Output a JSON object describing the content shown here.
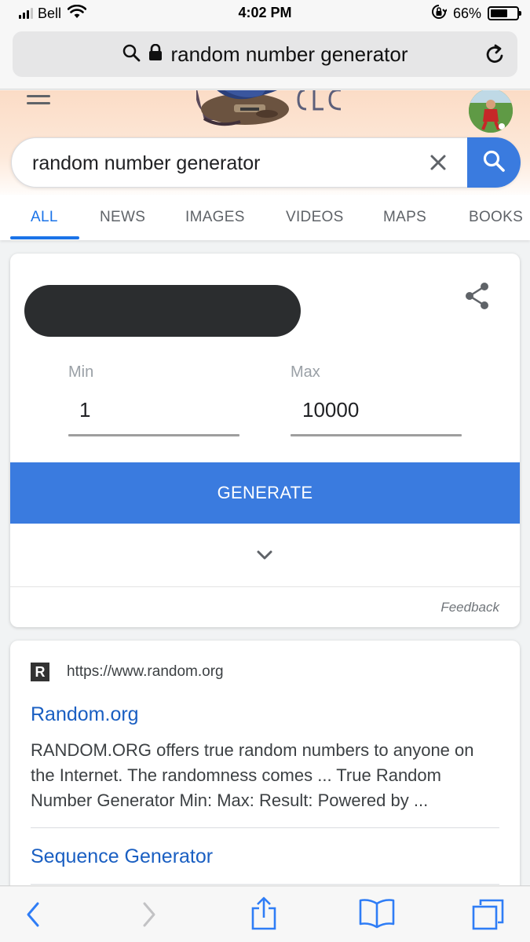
{
  "status_bar": {
    "carrier": "Bell",
    "time": "4:02 PM",
    "battery_percent": "66%",
    "battery_level": 0.66,
    "icons": [
      "signal-icon",
      "wifi-icon",
      "orientation-lock-icon",
      "battery-icon"
    ]
  },
  "address_bar": {
    "text": "random number generator",
    "icons": [
      "search-icon",
      "lock-icon",
      "reload-icon"
    ]
  },
  "search": {
    "query": "random number generator",
    "icons": [
      "menu-icon",
      "clear-icon",
      "search-icon"
    ]
  },
  "tabs": [
    {
      "label": "ALL",
      "active": true
    },
    {
      "label": "NEWS"
    },
    {
      "label": "IMAGES"
    },
    {
      "label": "VIDEOS"
    },
    {
      "label": "MAPS"
    },
    {
      "label": "BOOKS"
    }
  ],
  "rng": {
    "min_label": "Min",
    "min_value": "1",
    "max_label": "Max",
    "max_value": "10000",
    "generate_label": "GENERATE",
    "feedback_label": "Feedback",
    "icons": [
      "share-icon",
      "chevron-down-icon"
    ]
  },
  "result": {
    "favicon_letter": "R",
    "url": "https://www.random.org",
    "title": "Random.org",
    "snippet": "RANDOM.ORG offers true random numbers to anyone on the Internet. The randomness comes ... True Random Number Generator Min: Max: Result: Powered by ...",
    "sublink": "Sequence Generator"
  },
  "toolbar": {
    "icons": [
      "back-icon",
      "forward-icon",
      "share-icon",
      "bookmarks-icon",
      "tabs-icon"
    ]
  },
  "colors": {
    "accent": "#3a7bdf",
    "link": "#1a5fc2",
    "tab_active": "#1a73e8"
  }
}
